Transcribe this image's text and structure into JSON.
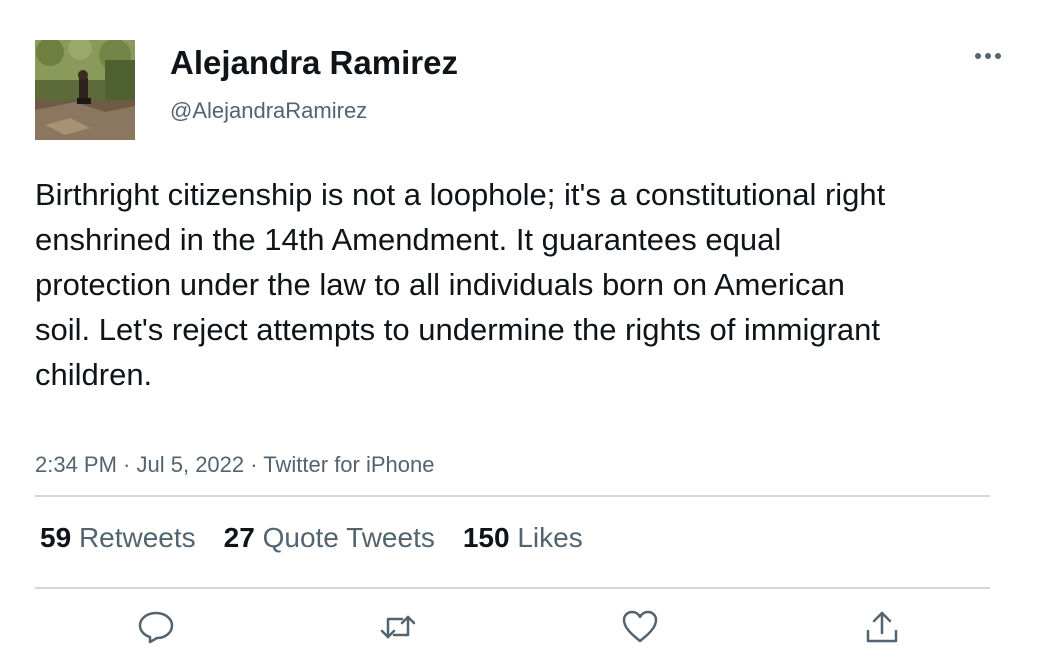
{
  "author": {
    "name": "Alejandra Ramirez",
    "handle": "@AlejandraRamirez"
  },
  "tweet": {
    "text": "Birthright citizenship is not a loophole; it's a constitutional right enshrined in the 14th Amendment. It guarantees equal protection under the law to all individuals born on American soil. Let's reject attempts to undermine the rights of immigrant children.",
    "time": "2:34 PM",
    "date": "Jul 5, 2022",
    "source": "Twitter for iPhone",
    "separator": " · "
  },
  "stats": {
    "retweets_count": "59",
    "retweets_label": "Retweets",
    "quotes_count": "27",
    "quotes_label": "Quote Tweets",
    "likes_count": "150",
    "likes_label": "Likes"
  },
  "icons": {
    "more": "more-horizontal-icon",
    "reply": "reply-icon",
    "retweet": "retweet-icon",
    "like": "heart-icon",
    "share": "share-icon"
  },
  "colors": {
    "text_primary": "#0f1419",
    "text_secondary": "#536471",
    "divider": "#cfd9de"
  }
}
